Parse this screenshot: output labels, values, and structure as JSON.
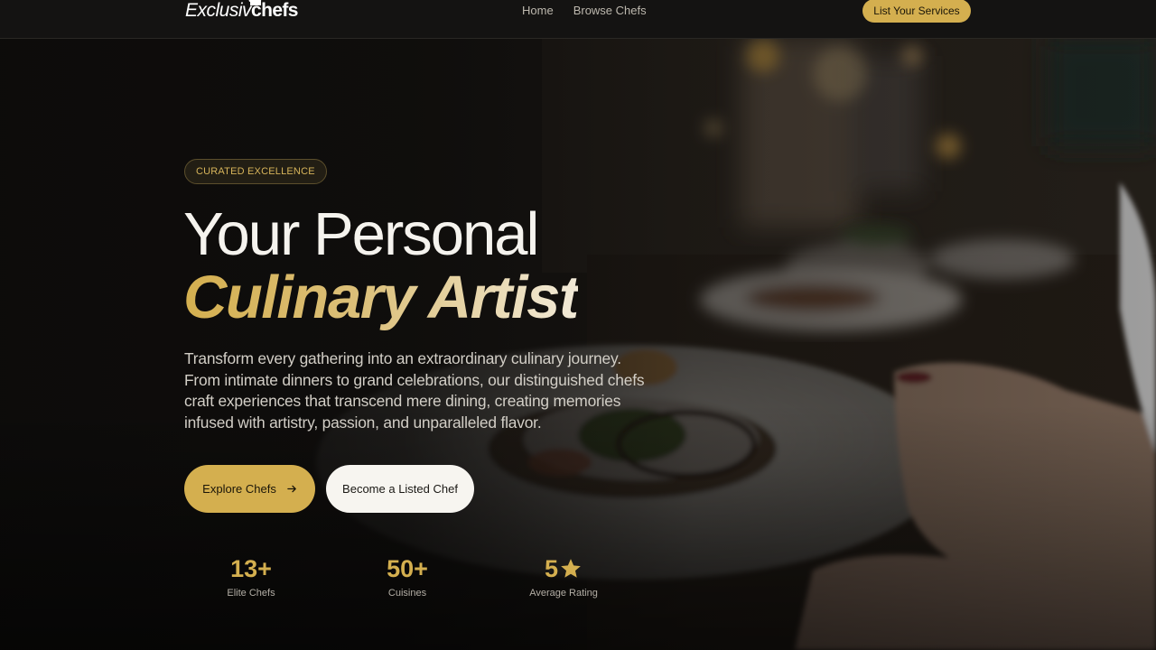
{
  "header": {
    "logo_light": "Exclusiv",
    "logo_bold": "chefs",
    "nav": [
      {
        "label": "Home"
      },
      {
        "label": "Browse Chefs"
      }
    ],
    "cta_label": "List Your Services"
  },
  "hero": {
    "badge": "CURATED EXCELLENCE",
    "title_line1": "Your Personal",
    "title_line2": "Culinary Artist",
    "description": "Transform every gathering into an extraordinary culinary journey. From intimate dinners to grand celebrations, our distinguished chefs craft experiences that transcend mere dining, creating memories infused with artistry, passion, and unparalleled flavor.",
    "primary_button": "Explore Chefs",
    "secondary_button": "Become a Listed Chef",
    "background_image": "restaurant-plate-photo"
  },
  "stats": [
    {
      "value": "13+",
      "label": "Elite Chefs"
    },
    {
      "value": "50+",
      "label": "Cuisines"
    },
    {
      "value": "5",
      "label": "Average Rating",
      "icon": "star-icon"
    }
  ],
  "colors": {
    "accent": "#d4af4f",
    "background": "#0f0e0c",
    "text_muted": "#b3aea5"
  }
}
